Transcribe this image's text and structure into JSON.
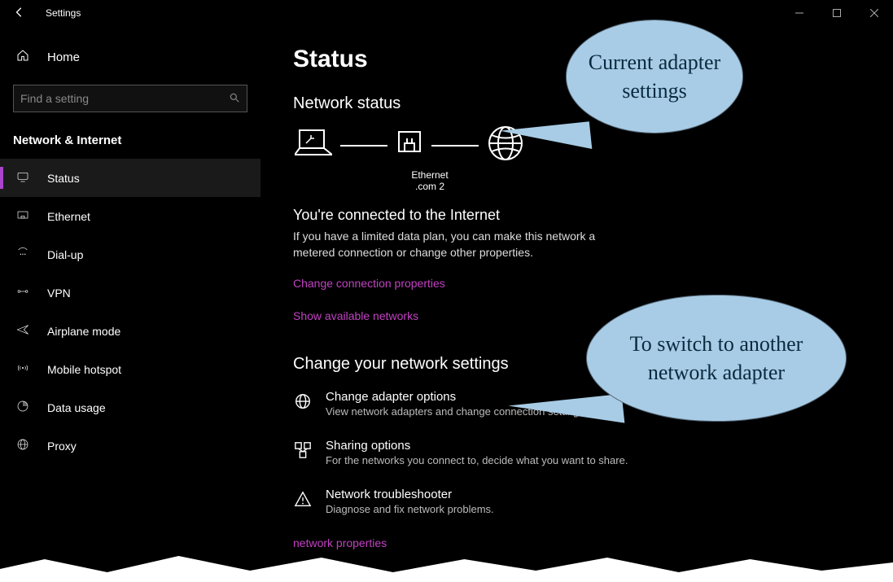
{
  "window": {
    "title": "Settings"
  },
  "sidebar": {
    "home": "Home",
    "search_placeholder": "Find a setting",
    "section": "Network & Internet",
    "items": [
      {
        "label": "Status"
      },
      {
        "label": "Ethernet"
      },
      {
        "label": "Dial-up"
      },
      {
        "label": "VPN"
      },
      {
        "label": "Airplane mode"
      },
      {
        "label": "Mobile hotspot"
      },
      {
        "label": "Data usage"
      },
      {
        "label": "Proxy"
      }
    ]
  },
  "main": {
    "title": "Status",
    "network_status": "Network status",
    "adapter_name": "Ethernet",
    "adapter_sub": ".com  2",
    "connected_heading": "You're connected to the Internet",
    "connected_desc": "If you have a limited data plan, you can make this network a metered connection or change other properties.",
    "link_change_conn": "Change connection properties",
    "link_show_networks": "Show available networks",
    "change_heading": "Change your network settings",
    "options": [
      {
        "title": "Change adapter options",
        "desc": "View network adapters and change connection settings."
      },
      {
        "title": "Sharing options",
        "desc": "For the networks you connect to, decide what you want to share."
      },
      {
        "title": "Network troubleshooter",
        "desc": "Diagnose and fix network problems."
      }
    ],
    "link_view_properties": "network properties"
  },
  "callouts": {
    "c1": "Current adapter settings",
    "c2": "To switch to another network adapter"
  }
}
